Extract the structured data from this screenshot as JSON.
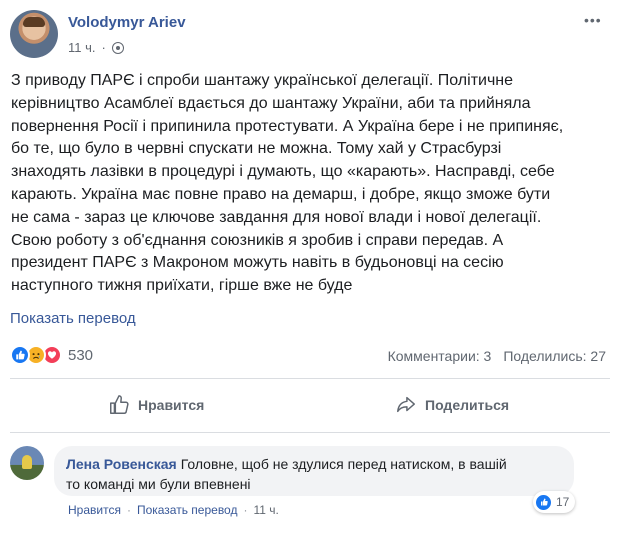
{
  "post": {
    "author": "Volodymyr Ariev",
    "time": "11 ч.",
    "separator": "·",
    "privacy_icon": "globe-icon",
    "more_icon": "ellipsis-icon",
    "more_glyph": "•••",
    "body_lines": [
      "З приводу ПАРЄ і спроби шантажу української делегації. Політичне",
      "керівництво Асамблеї вдається до шантажу України, аби та прийняла",
      "повернення Росії і припинила протестувати. А Україна бере і не припиняє,",
      "бо те, що було в червні спускати не можна. Тому хай у Страсбурзі",
      "знаходять лазівки в процедурі і думають, що «карають». Насправді, себе",
      "карають. Україна має повне право на демарш, і добре, якщо зможе бути",
      "не сама - зараз це ключове завдання для нової влади і нової делегації.",
      "Свою роботу з об'єднання союзників я зробив і справи передав. А",
      "президент ПАРЄ з Макроном можуть навіть в будьоновці на сесію",
      "наступного тижня приїхати, гірше вже не буде"
    ],
    "translate_link": "Показать перевод"
  },
  "reactions": {
    "icons": [
      "like-reaction",
      "sad-reaction",
      "love-reaction"
    ],
    "count": "530",
    "comments": "Комментарии: 3",
    "shares": "Поделились: 27"
  },
  "actions": {
    "like": "Нравится",
    "share": "Поделиться"
  },
  "comment": {
    "author": "Лена Ровенская",
    "text_line1": "Головне, щоб не здулися перед натиском, в вашій",
    "text_line2": "то команді ми були впевнені",
    "reaction_count": "17",
    "like_link": "Нравится",
    "translate_link": "Показать перевод",
    "time": "11 ч.",
    "dot": "·"
  },
  "colors": {
    "link": "#385898",
    "secondary_text": "#606770",
    "like_blue": "#1877f2",
    "love_red": "#f33e58",
    "sad_yellow": "#f7b125"
  }
}
